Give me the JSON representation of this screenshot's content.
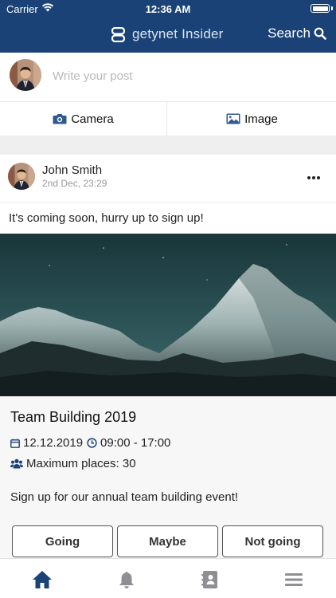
{
  "status_bar": {
    "carrier": "Carrier",
    "time": "12:36 AM"
  },
  "header": {
    "brand": "getynet Insider",
    "search_label": "Search"
  },
  "composer": {
    "placeholder": "Write your post",
    "camera_label": "Camera",
    "image_label": "Image"
  },
  "post": {
    "author": "John Smith",
    "date": "2nd Dec, 23:29",
    "text": "It's coming soon, hurry up to sign up!",
    "event": {
      "title": "Team Building 2019",
      "date": "12.12.2019",
      "time": "09:00 - 17:00",
      "places": "Maximum places: 30",
      "description": "Sign up for our annual team building event!"
    },
    "rsvp": {
      "going": "Going",
      "maybe": "Maybe",
      "not_going": "Not going"
    }
  },
  "tabbar": {
    "items": [
      "home-icon",
      "bell-icon",
      "contacts-icon",
      "menu-icon"
    ],
    "active": "home-icon"
  },
  "colors": {
    "header": "#1b4276",
    "accent": "#1b4276",
    "inactive": "#8e8e93"
  }
}
